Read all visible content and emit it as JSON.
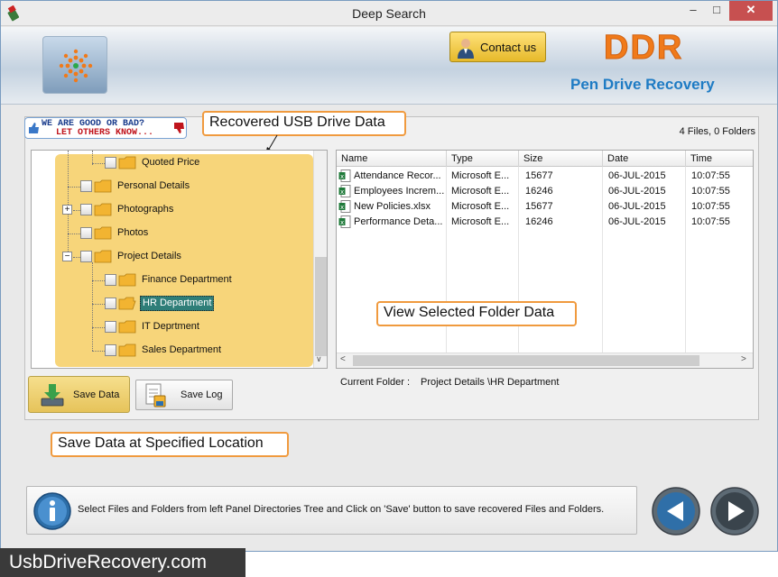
{
  "window": {
    "title": "Deep Search",
    "min_glyph": "–",
    "max_glyph": "□",
    "close_glyph": "✕"
  },
  "banner": {
    "contact_label": "Contact us",
    "brand": "DDR",
    "product": "Pen Drive Recovery"
  },
  "rating": {
    "line1": "WE ARE GOOD OR BAD?",
    "line2": "LET OTHERS KNOW..."
  },
  "callouts": {
    "usb": "Recovered USB Drive Data",
    "view": "View Selected Folder Data",
    "save": "Save Data at Specified Location"
  },
  "file_count": "4 Files, 0 Folders",
  "tree": {
    "items": [
      {
        "label": "Quoted Price"
      },
      {
        "label": "Personal Details"
      },
      {
        "label": "Photographs",
        "expander": "+"
      },
      {
        "label": "Photos"
      },
      {
        "label": "Project Details",
        "expander": "−"
      },
      {
        "label": "Finance Department"
      },
      {
        "label": "HR Department"
      },
      {
        "label": "IT Deprtment"
      },
      {
        "label": "Sales Department"
      }
    ],
    "scroll_glyph": "∨"
  },
  "list": {
    "columns": [
      "Name",
      "Type",
      "Size",
      "Date",
      "Time"
    ],
    "rows": [
      [
        "Attendance Recor...",
        "Microsoft E...",
        "15677",
        "06-JUL-2015",
        "10:07:55"
      ],
      [
        "Employees Increm...",
        "Microsoft E...",
        "16246",
        "06-JUL-2015",
        "10:07:55"
      ],
      [
        "New Policies.xlsx",
        "Microsoft E...",
        "15677",
        "06-JUL-2015",
        "10:07:55"
      ],
      [
        "Performance Deta...",
        "Microsoft E...",
        "16246",
        "06-JUL-2015",
        "10:07:55"
      ]
    ],
    "scroll_left": "<",
    "scroll_right": ">"
  },
  "current_folder": {
    "label": "Current Folder :",
    "value": "Project Details \\HR Department"
  },
  "buttons": {
    "save_data": "Save Data",
    "save_log": "Save Log"
  },
  "status": {
    "message": "Select Files and Folders from left Panel Directories Tree and Click on 'Save' button to save recovered Files and Folders."
  },
  "watermark": "UsbDriveRecovery.com",
  "colors": {
    "accent_orange": "#f07a1a",
    "accent_blue": "#1e7bc4",
    "tree_highlight": "#f7d57a",
    "selection": "#2f7e78"
  },
  "icons": {
    "app": "usb-drive-icon",
    "logo": "radar-logo-icon",
    "contact": "person-icon",
    "file": "excel-file-icon",
    "save_data": "download-tray-icon",
    "save_log": "document-log-icon",
    "info": "info-icon",
    "back": "back-arrow-icon",
    "next": "play-next-icon"
  }
}
